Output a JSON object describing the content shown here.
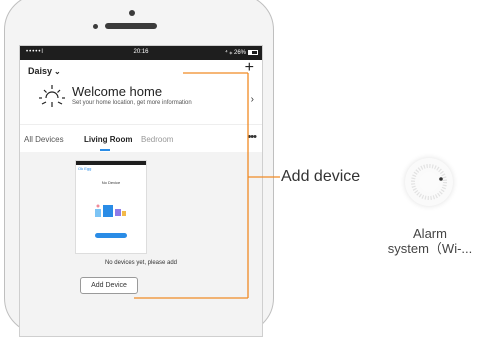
{
  "statusbar": {
    "signal": "•••••l",
    "time": "20:16",
    "right": "⁴ ⁎ 26%"
  },
  "header": {
    "user": "Daisy",
    "add_icon": "plus-icon"
  },
  "welcome": {
    "title": "Welcome home",
    "subtitle": "Set your home location, get more information"
  },
  "tabs": [
    {
      "label": "All Devices",
      "active": false
    },
    {
      "label": "Living Room",
      "active": true
    },
    {
      "label": "Bedroom",
      "active": false
    }
  ],
  "empty_state": {
    "mini_header": "Ok Egg",
    "mini_title": "No Device",
    "message": "No devices yet, please add",
    "button": "Add Device"
  },
  "callout": {
    "label": "Add device",
    "color": "#f08a24"
  },
  "device": {
    "name_line1": "Alarm",
    "name_line2": "system（Wi-..."
  }
}
